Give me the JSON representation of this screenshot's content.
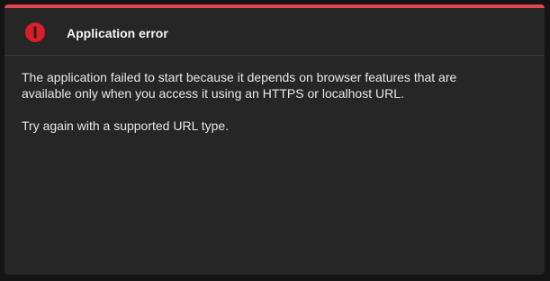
{
  "dialog": {
    "accent_color": "#e2474f",
    "icon": "error-icon",
    "title": "Application error",
    "line1": "The application failed to start because it depends on browser features that are",
    "line2": "available only when you access it using an HTTPS or localhost URL.",
    "message2": "Try again with a supported URL type."
  }
}
